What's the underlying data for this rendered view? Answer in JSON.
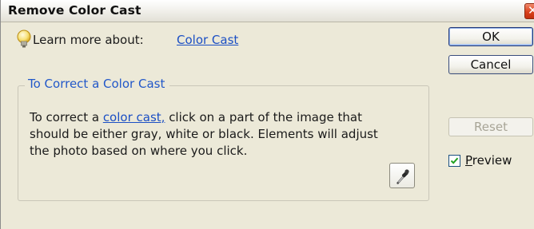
{
  "window": {
    "title": "Remove Color Cast",
    "close_glyph": "✕"
  },
  "learn_more": {
    "label": "Learn more about:",
    "link": "Color Cast",
    "icon": "lightbulb-icon"
  },
  "buttons": {
    "ok": "OK",
    "cancel": "Cancel",
    "reset": "Reset"
  },
  "preview": {
    "label_underlined": "P",
    "label_rest": "review",
    "checked": true
  },
  "group": {
    "title": "To Correct a Color Cast",
    "text_before": "To correct a ",
    "text_link": "color cast,",
    "text_after": " click on a part of the image that should be either gray, white or black. Elements will adjust the photo based on where you click.",
    "tool_icon": "eyedropper-icon"
  },
  "colors": {
    "dialog_bg": "#ece9d8",
    "link": "#1b4fc4",
    "group_title": "#2258c9",
    "close_red": "#d9411d"
  }
}
